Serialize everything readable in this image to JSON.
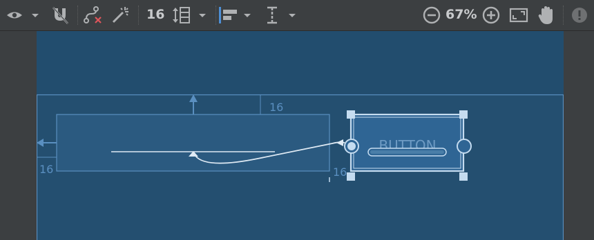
{
  "toolbar": {
    "view_options_icon": "eye-icon",
    "magnet_icon": "magnet-off-icon",
    "clear_constraints_icon": "constraint-clear-icon",
    "infer_constraints_icon": "magic-wand-icon",
    "default_margin": "16",
    "pack_icon": "pack-expand-icon",
    "align_icon": "align-left-icon",
    "guidelines_icon": "guideline-vertical-icon",
    "zoom_out_icon": "zoom-out-icon",
    "zoom_level": "67%",
    "zoom_in_icon": "zoom-in-icon",
    "zoom_fit_icon": "zoom-to-fit-icon",
    "pan_icon": "hand-icon",
    "warnings_icon": "warning-icon"
  },
  "design": {
    "button_text": "BUTTON",
    "margin_top": "16",
    "margin_left": "16",
    "margin_button": "16"
  },
  "colors": {
    "canvas": "#224d6e",
    "toolbar": "#3c3f41",
    "blueprint_line": "#5a8fc0",
    "selection": "#c5dcf0",
    "error_red": "#e0555b"
  }
}
